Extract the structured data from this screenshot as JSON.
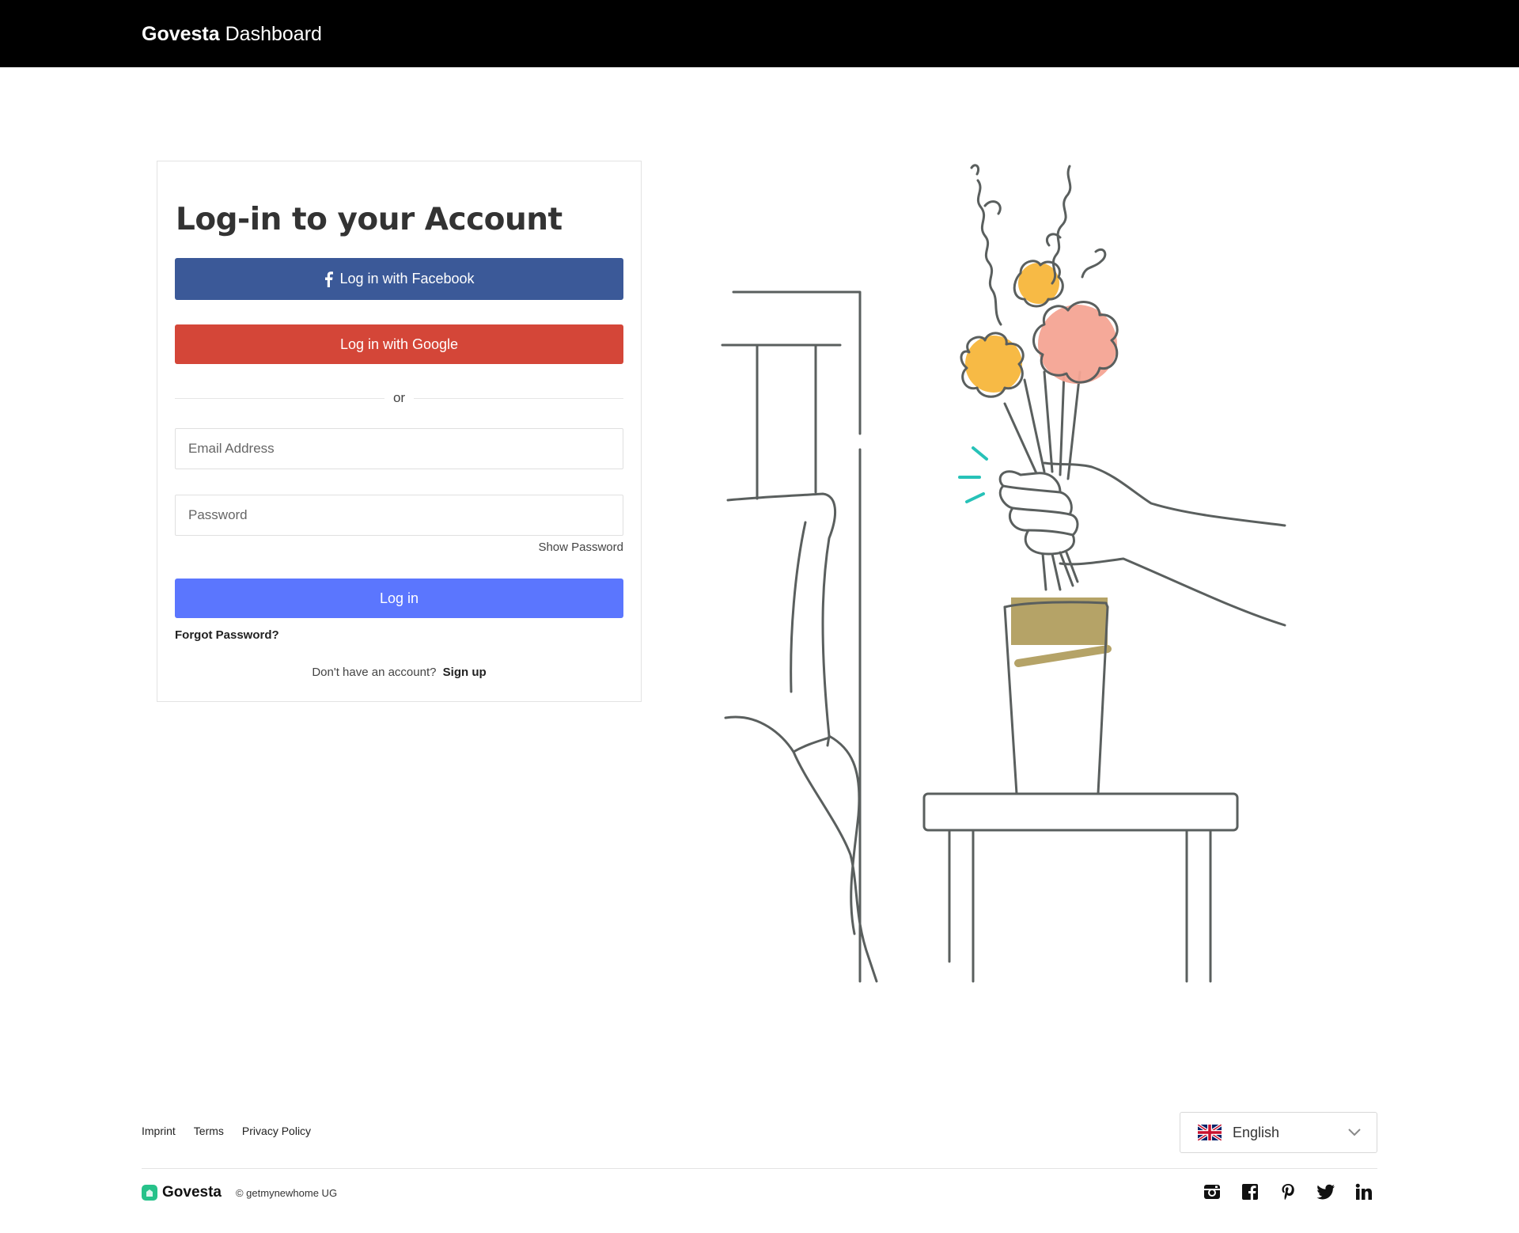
{
  "header": {
    "brand_strong": "Govesta",
    "brand_light": "Dashboard"
  },
  "login": {
    "title": "Log-in to your Account",
    "facebook_label": "Log in with Facebook",
    "google_label": "Log in with Google",
    "divider_text": "or",
    "email_placeholder": "Email Address",
    "password_placeholder": "Password",
    "show_password": "Show Password",
    "login_label": "Log in",
    "forgot_password": "Forgot Password?",
    "no_account_text": "Don't have an account?",
    "signup_label": "Sign up"
  },
  "footer": {
    "links": [
      "Imprint",
      "Terms",
      "Privacy Policy"
    ],
    "language": "English",
    "brand": "Govesta",
    "copyright": "© getmynewhome UG",
    "social_icons": [
      "instagram-icon",
      "facebook-icon",
      "pinterest-icon",
      "twitter-icon",
      "linkedin-icon"
    ]
  },
  "colors": {
    "facebook": "#3b5998",
    "google": "#d44638",
    "primary": "#5b76fe",
    "brand_green": "#27c28a",
    "vase_gold": "#b5a367",
    "flower_orange": "#f6b331",
    "flower_pink": "#f4a494",
    "spark_teal": "#27c2b8"
  }
}
